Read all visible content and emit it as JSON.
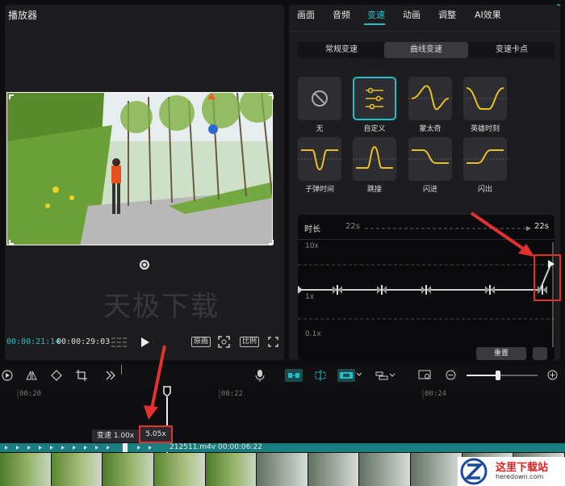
{
  "player": {
    "title": "播放器",
    "time_current": "00:00:21:14",
    "time_total": "00:00:29:03",
    "watermark": "天极下载",
    "btn_original": "原画",
    "btn_ratio": "比例"
  },
  "right_panel": {
    "tabs": [
      "画面",
      "音频",
      "变速",
      "动画",
      "调整",
      "AI效果"
    ],
    "active_tab": "变速",
    "speed_modes": [
      "常规变速",
      "曲线变速",
      "变速卡点"
    ],
    "active_mode": "曲线变速",
    "presets": [
      {
        "label": "无",
        "icon": "none-icon"
      },
      {
        "label": "自定义",
        "icon": "custom-sliders-icon",
        "selected": true
      },
      {
        "label": "蒙太奇",
        "icon": "montage-curve-icon"
      },
      {
        "label": "英雄时刻",
        "icon": "hero-moment-curve-icon"
      },
      {
        "label": "子弹时间",
        "icon": "bullet-time-curve-icon"
      },
      {
        "label": "跳接",
        "icon": "jump-cut-curve-icon"
      },
      {
        "label": "闪进",
        "icon": "flash-in-curve-icon"
      },
      {
        "label": "闪出",
        "icon": "flash-out-curve-icon"
      }
    ],
    "editor": {
      "duration_label": "时长",
      "duration_from": "22s",
      "duration_to": "22s",
      "axis_top": "10x",
      "axis_mid": "1x",
      "axis_bottom": "0.1x",
      "reset_label": "重置"
    }
  },
  "timeline": {
    "ruler": [
      "00:20",
      "00:22",
      "00:24"
    ],
    "tooltip_prefix": "变速 1.00x",
    "tooltip_value": "5.05x",
    "clip_name": "212511.m4v",
    "clip_duration": "00:00:06:22"
  },
  "brand": {
    "site_name": "这里下载站",
    "site_url": "heredown.com"
  },
  "colors": {
    "accent": "#20c0c8",
    "highlight_red": "#e53030",
    "curve_yellow": "#e8c020"
  }
}
